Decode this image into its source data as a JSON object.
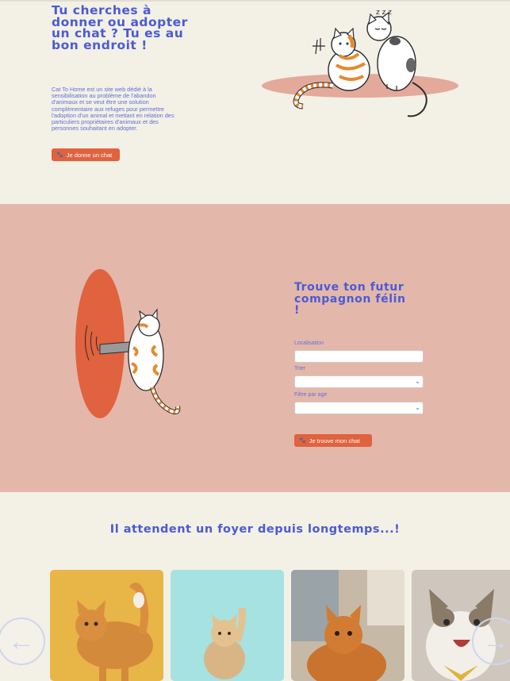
{
  "hero": {
    "title": "Tu cherches à donner ou adopter un chat ? Tu es au bon endroit !",
    "description": "Cat To Home est un site web dédié à la sensibilisation au problème de l'abandon d'animaux et se veut être une solution complémentaire aux refuges pour permettre l'adoption d'un animal et mettant en relation des particuliers propriétaires d'animaux et des personnes souhaitant en adopter.",
    "give_button": "Je donne un chat",
    "art_icon": "two-cats-illustration"
  },
  "find": {
    "title": "Trouve ton futur compagnon félin !",
    "location_label": "Localisation",
    "location_value": "",
    "sort_label": "Trier",
    "sort_value": "",
    "age_label": "Filtre par age",
    "age_value": "",
    "find_button": "Je trouve mon chat",
    "art_icon": "cat-through-portal-illustration"
  },
  "waiting": {
    "title": "Il attendent un foyer depuis longtemps...!",
    "prev_icon": "arrow-left-icon",
    "next_icon": "arrow-right-icon",
    "cards": [
      {
        "photo": "ginger-cat-yellow-background"
      },
      {
        "photo": "kitten-paw-up-cyan-background"
      },
      {
        "photo": "fluffy-orange-cat-indoor"
      },
      {
        "photo": "happy-tabby-cat-bandana"
      }
    ]
  },
  "colors": {
    "accent": "#e0623e",
    "title_blue": "#4a5bd4",
    "background": "#f3f0e6",
    "pink_section": "#e4b7ab"
  }
}
